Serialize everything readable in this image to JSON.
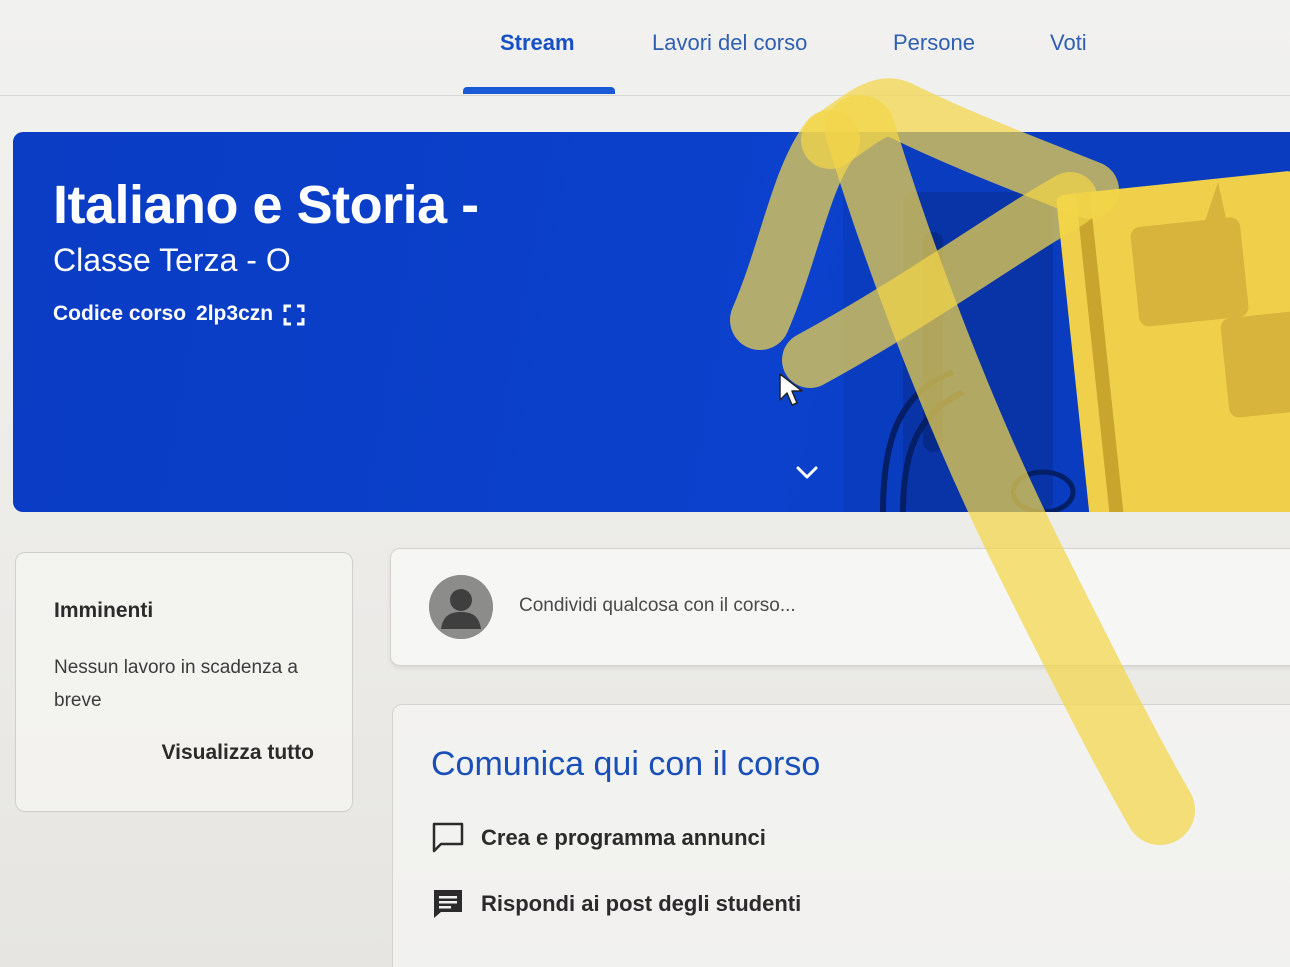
{
  "nav": {
    "tabs": [
      {
        "label": "Stream",
        "active": true
      },
      {
        "label": "Lavori del corso",
        "active": false
      },
      {
        "label": "Persone",
        "active": false
      },
      {
        "label": "Voti",
        "active": false
      }
    ]
  },
  "banner": {
    "title": "Italiano e Storia -",
    "section": "Classe Terza - O",
    "code_label": "Codice corso",
    "code_value": "2lp3czn",
    "color": "#0b41cc",
    "icons": [
      "fullscreen-icon",
      "chevron-down-icon"
    ]
  },
  "upcoming": {
    "title": "Imminenti",
    "empty_text": "Nessun lavoro in scadenza a breve",
    "view_all": "Visualizza tutto"
  },
  "share": {
    "placeholder": "Condividi qualcosa con il corso..."
  },
  "communicate": {
    "title": "Comunica qui con il corso",
    "items": [
      {
        "label": "Crea e programma annunci",
        "icon": "announcement-icon"
      },
      {
        "label": "Rispondi ai post degli studenti",
        "icon": "comment-icon"
      }
    ]
  },
  "colors": {
    "accent": "#1a5ad6",
    "highlighter": "#f3d64a"
  }
}
